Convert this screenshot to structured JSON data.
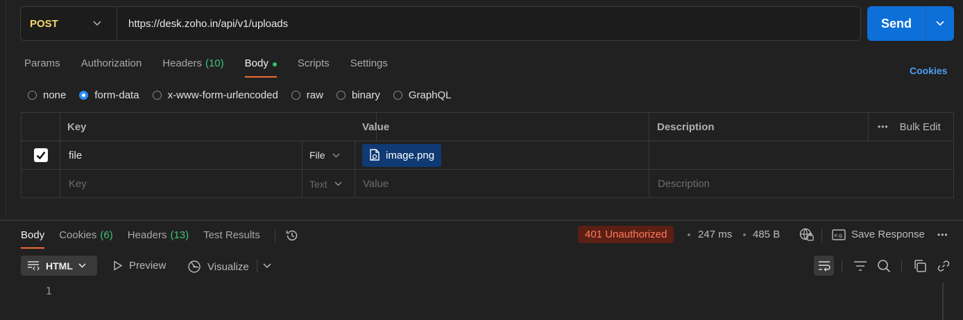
{
  "request": {
    "method": "POST",
    "url": "https://desk.zoho.in/api/v1/uploads",
    "send_label": "Send"
  },
  "request_tabs": [
    {
      "label": "Params",
      "count": ""
    },
    {
      "label": "Authorization",
      "count": ""
    },
    {
      "label": "Headers",
      "count": "(10)"
    },
    {
      "label": "Body",
      "count": "",
      "active": true
    },
    {
      "label": "Scripts",
      "count": ""
    },
    {
      "label": "Settings",
      "count": ""
    }
  ],
  "cookies_link": "Cookies",
  "body_modes": [
    {
      "label": "none",
      "selected": false
    },
    {
      "label": "form-data",
      "selected": true
    },
    {
      "label": "x-www-form-urlencoded",
      "selected": false
    },
    {
      "label": "raw",
      "selected": false
    },
    {
      "label": "binary",
      "selected": false
    },
    {
      "label": "GraphQL",
      "selected": false
    }
  ],
  "params_table": {
    "headers": {
      "key": "Key",
      "value": "Value",
      "description": "Description",
      "bulk_edit": "Bulk Edit"
    },
    "row": {
      "key": "file",
      "type": "File",
      "value": "image.png",
      "description": ""
    },
    "empty_row": {
      "key": "Key",
      "type": "Text",
      "value": "Value",
      "description": "Description"
    }
  },
  "response_tabs": [
    {
      "label": "Body",
      "count": "",
      "active": true
    },
    {
      "label": "Cookies",
      "count": "(6)"
    },
    {
      "label": "Headers",
      "count": "(13)"
    },
    {
      "label": "Test Results",
      "count": ""
    }
  ],
  "response": {
    "status": "401 Unauthorized",
    "time": "247 ms",
    "size": "485 B",
    "save_response": "Save Response",
    "format": "HTML",
    "preview": "Preview",
    "visualize": "Visualize",
    "line_number": "1"
  },
  "colors": {
    "background": "#212121",
    "accent_blue": "#0d6fd8",
    "method_yellow": "#f7d96c",
    "tab_underline": "#f26b3a",
    "count_green": "#3ec27a",
    "status_error": "#ff7b5c"
  }
}
